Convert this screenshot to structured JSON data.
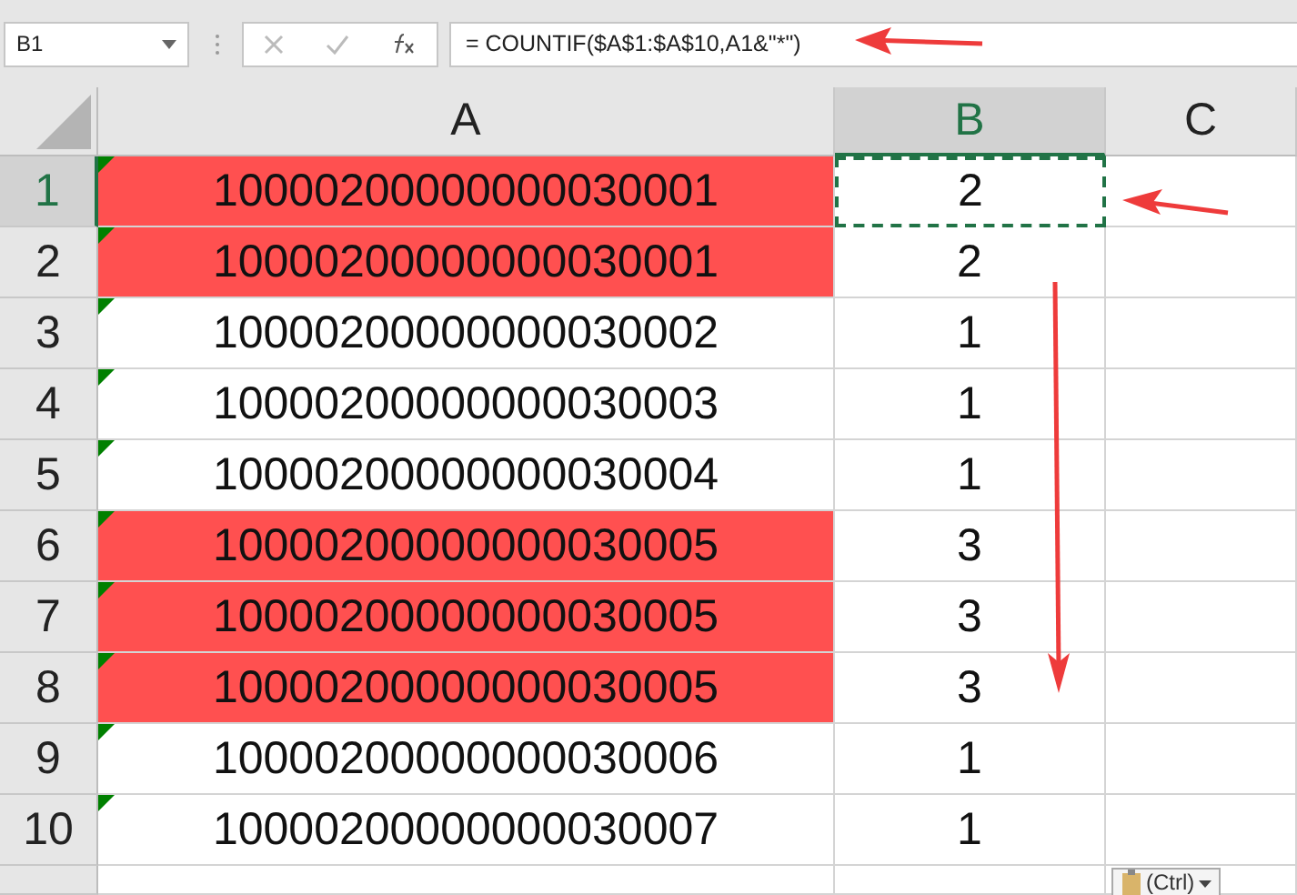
{
  "name_box": "B1",
  "formula": "= COUNTIF($A$1:$A$10,A1&\"*\")",
  "columns": [
    {
      "label": "A",
      "selected": false
    },
    {
      "label": "B",
      "selected": true
    },
    {
      "label": "C",
      "selected": false
    }
  ],
  "rows": [
    {
      "number": "1",
      "a": "10000200000000030001",
      "b": "2",
      "highlighted": true,
      "selected": true
    },
    {
      "number": "2",
      "a": "10000200000000030001",
      "b": "2",
      "highlighted": true,
      "selected": false
    },
    {
      "number": "3",
      "a": "10000200000000030002",
      "b": "1",
      "highlighted": false,
      "selected": false
    },
    {
      "number": "4",
      "a": "10000200000000030003",
      "b": "1",
      "highlighted": false,
      "selected": false
    },
    {
      "number": "5",
      "a": "10000200000000030004",
      "b": "1",
      "highlighted": false,
      "selected": false
    },
    {
      "number": "6",
      "a": "10000200000000030005",
      "b": "3",
      "highlighted": true,
      "selected": false
    },
    {
      "number": "7",
      "a": "10000200000000030005",
      "b": "3",
      "highlighted": true,
      "selected": false
    },
    {
      "number": "8",
      "a": "10000200000000030005",
      "b": "3",
      "highlighted": true,
      "selected": false
    },
    {
      "number": "9",
      "a": "10000200000000030006",
      "b": "1",
      "highlighted": false,
      "selected": false
    },
    {
      "number": "10",
      "a": "10000200000000030007",
      "b": "1",
      "highlighted": false,
      "selected": false
    }
  ],
  "paste_options": {
    "label": "(Ctrl)"
  }
}
